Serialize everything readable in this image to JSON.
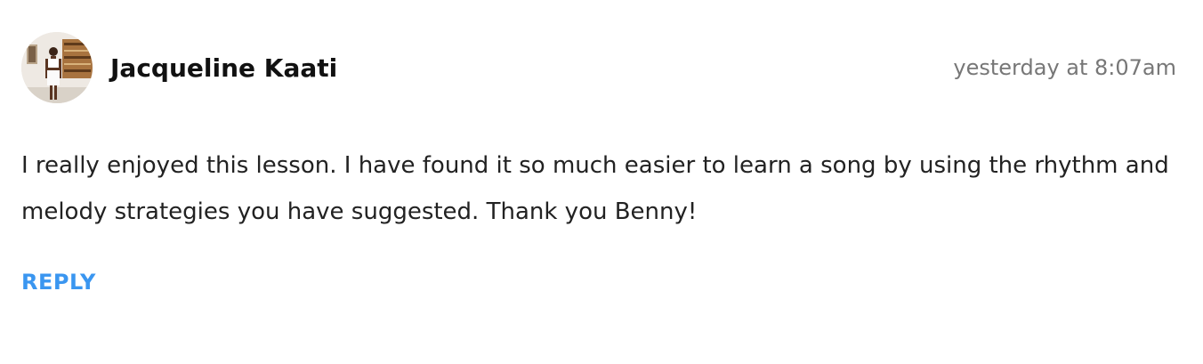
{
  "comment": {
    "author": "Jacqueline Kaati",
    "timestamp": "yesterday at 8:07am",
    "body": "I really enjoyed this lesson. I have found it so much easier to learn a song by using the rhythm and melody strategies you have suggested. Thank you Benny!",
    "reply_label": "REPLY"
  },
  "colors": {
    "reply_link": "#3a96f0",
    "timestamp": "#777777",
    "author": "#111111",
    "body_text": "#222222"
  }
}
